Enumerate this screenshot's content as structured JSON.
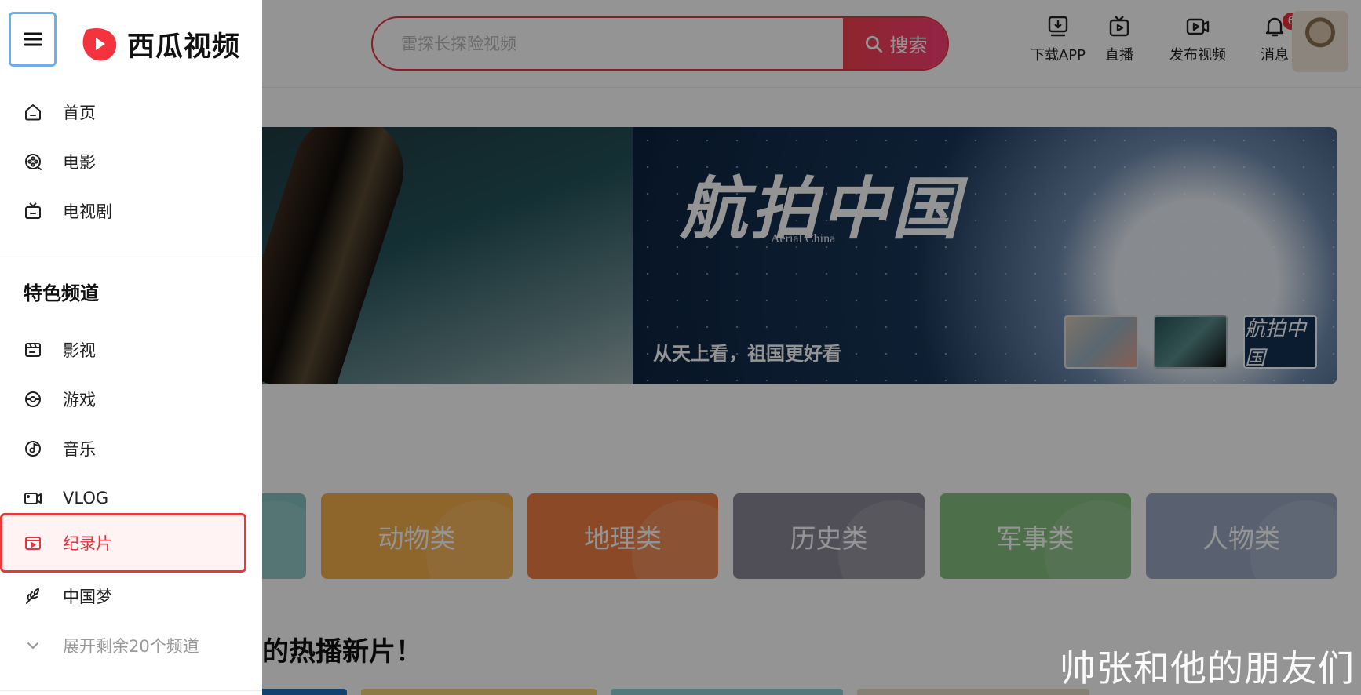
{
  "sidebar": {
    "logo_text": "西瓜视频",
    "primary_items": [
      {
        "label": "首页",
        "icon": "home-icon"
      },
      {
        "label": "电影",
        "icon": "film-reel-icon"
      },
      {
        "label": "电视剧",
        "icon": "tv-icon"
      }
    ],
    "section_title": "特色频道",
    "channel_items": [
      {
        "label": "影视",
        "icon": "clapperboard-icon"
      },
      {
        "label": "游戏",
        "icon": "game-icon"
      },
      {
        "label": "音乐",
        "icon": "music-disc-icon"
      },
      {
        "label": "VLOG",
        "icon": "camera-icon"
      },
      {
        "label": "纪录片",
        "icon": "documentary-icon",
        "active": true
      },
      {
        "label": "中国梦",
        "icon": "wheat-icon"
      }
    ],
    "expand_label": "展开剩余20个频道"
  },
  "header": {
    "search_placeholder": "雷探长探险视频",
    "search_button": "搜索",
    "actions": [
      {
        "label": "下载APP",
        "icon": "download-icon"
      },
      {
        "label": "直播",
        "icon": "live-tv-icon"
      },
      {
        "label": "发布视频",
        "icon": "upload-video-icon"
      },
      {
        "label": "消息",
        "icon": "bell-icon",
        "badge": "6"
      }
    ]
  },
  "banner": {
    "title_cn": "航拍中国",
    "title_en": "Aerial China",
    "caption": "从天上看，祖国更好看",
    "thumb_3_text": "航拍中国"
  },
  "categories": [
    "动物类",
    "地理类",
    "历史类",
    "军事类",
    "人物类"
  ],
  "section_title": "过的热播新片！",
  "watermark": "帅张和他的朋友们",
  "colors": {
    "accent": "#e8343f",
    "active_border": "#e6393c",
    "menu_focus": "#6ab0ec"
  }
}
